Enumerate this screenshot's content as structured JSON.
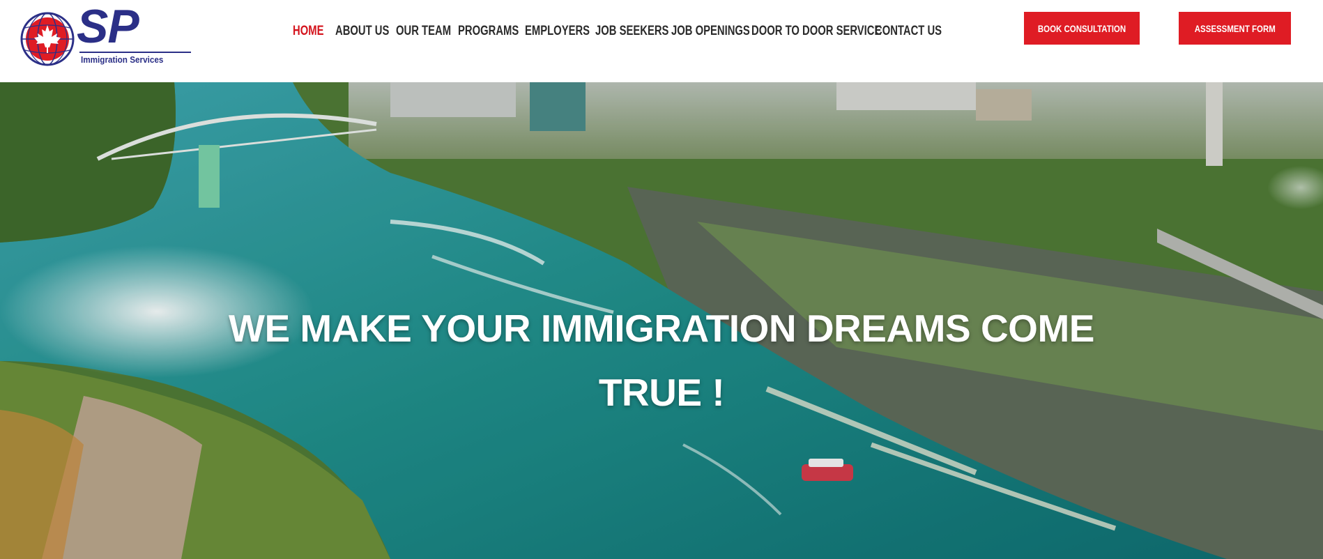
{
  "brand": {
    "logo_text": "SP",
    "logo_subtitle": "Immigration Services",
    "colors": {
      "primary_blue": "#2b2f87",
      "accent_red": "#df1c24",
      "nav_text": "#2b2b2b"
    }
  },
  "nav": {
    "items": [
      {
        "label": "HOME",
        "active": true
      },
      {
        "label": "ABOUT US",
        "active": false
      },
      {
        "label": "OUR TEAM",
        "active": false
      },
      {
        "label": "PROGRAMS",
        "active": false
      },
      {
        "label": "EMPLOYERS",
        "active": false
      },
      {
        "label": "JOB SEEKERS",
        "active": false
      },
      {
        "label": "JOB OPENINGS",
        "active": false
      },
      {
        "label": "DOOR TO DOOR SERVICE",
        "active": false
      },
      {
        "label": "CONTACT US",
        "active": false
      }
    ]
  },
  "cta": {
    "book_label": "BOOK CONSULTATION",
    "assessment_label": "ASSESSMENT FORM"
  },
  "hero": {
    "headline": "WE MAKE YOUR IMMIGRATION DREAMS COME TRUE !",
    "background_icon": "aerial-waterfall-river-image"
  }
}
